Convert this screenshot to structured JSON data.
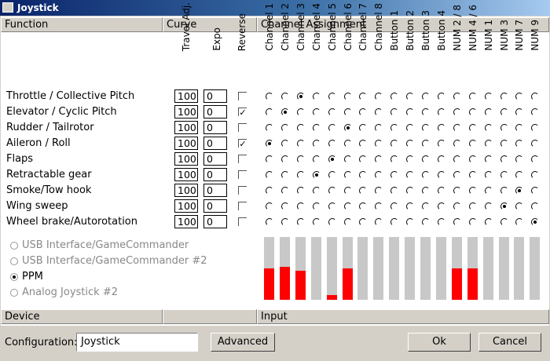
{
  "window": {
    "title": "Joystick"
  },
  "headers": {
    "function": "Function",
    "curve": "Curve",
    "channel_assignment": "Channel Assignment",
    "device": "Device",
    "input": "Input"
  },
  "curve_columns": [
    "Travel Adj.",
    "Expo",
    "Reverse"
  ],
  "channels": [
    "Channel 1",
    "Channel 2",
    "Channel 3",
    "Channel 4",
    "Channel 5",
    "Channel 6",
    "Channel 7",
    "Channel 8",
    "Button 1",
    "Button 2",
    "Button 3",
    "Button 4",
    "NUM 2 / 8",
    "NUM 4 / 6",
    "NUM 1",
    "NUM 3",
    "NUM 7",
    "NUM 9"
  ],
  "functions": [
    {
      "name": "Throttle / Collective Pitch",
      "travel": "100",
      "expo": "0",
      "reverse": false,
      "channel": 2
    },
    {
      "name": "Elevator / Cyclic Pitch",
      "travel": "100",
      "expo": "0",
      "reverse": true,
      "channel": 1
    },
    {
      "name": "Rudder / Tailrotor",
      "travel": "100",
      "expo": "0",
      "reverse": false,
      "channel": 5
    },
    {
      "name": "Aileron / Roll",
      "travel": "100",
      "expo": "0",
      "reverse": true,
      "channel": 0
    },
    {
      "name": "Flaps",
      "travel": "100",
      "expo": "0",
      "reverse": false,
      "channel": 4
    },
    {
      "name": "Retractable gear",
      "travel": "100",
      "expo": "0",
      "reverse": false,
      "channel": 3
    },
    {
      "name": "Smoke/Tow hook",
      "travel": "100",
      "expo": "0",
      "reverse": false,
      "channel": 16
    },
    {
      "name": "Wing sweep",
      "travel": "100",
      "expo": "0",
      "reverse": false,
      "channel": 15
    },
    {
      "name": "Wheel brake/Autorotation",
      "travel": "100",
      "expo": "0",
      "reverse": false,
      "channel": 17
    }
  ],
  "devices": [
    {
      "label": "USB Interface/GameCommander",
      "selected": false
    },
    {
      "label": "USB Interface/GameCommander #2",
      "selected": false
    },
    {
      "label": "PPM",
      "selected": true
    },
    {
      "label": "Analog Joystick #2",
      "selected": false
    }
  ],
  "input_levels": [
    0.5,
    0.52,
    0.46,
    0,
    0.07,
    0.5,
    0,
    0,
    0,
    0,
    0,
    0,
    0.5,
    0.5,
    0,
    0,
    0,
    0
  ],
  "configuration": {
    "label": "Configuration:",
    "value": "Joystick"
  },
  "buttons": {
    "advanced": "Advanced",
    "ok": "Ok",
    "cancel": "Cancel"
  },
  "colors": {
    "input_fill": "#ff0000",
    "input_bg": "#c8c8c8",
    "title_bar": "#0a246a"
  }
}
